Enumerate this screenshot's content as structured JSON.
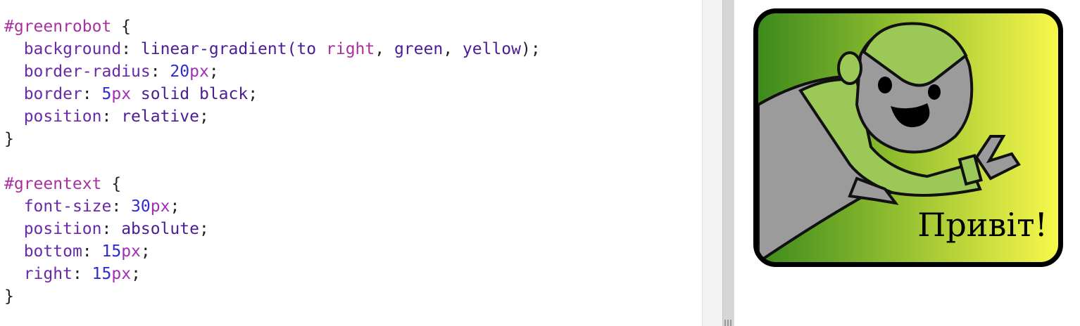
{
  "editor": {
    "lines": [
      {
        "selector": "#greenrobot",
        "open": " {"
      },
      {
        "property": "background",
        "tokens": [
          {
            "t": "linear-gradient(to ",
            "c": "val"
          },
          {
            "t": "right",
            "c": "sel"
          },
          {
            "t": ", ",
            "c": "punc"
          },
          {
            "t": "green",
            "c": "val"
          },
          {
            "t": ", ",
            "c": "punc"
          },
          {
            "t": "yellow",
            "c": "val"
          },
          {
            "t": ");",
            "c": "punc"
          }
        ]
      },
      {
        "property": "border-radius",
        "tokens": [
          {
            "t": "20",
            "c": "num"
          },
          {
            "t": "px",
            "c": "unit"
          },
          {
            "t": ";",
            "c": "punc"
          }
        ]
      },
      {
        "property": "border",
        "tokens": [
          {
            "t": "5",
            "c": "num"
          },
          {
            "t": "px",
            "c": "unit"
          },
          {
            "t": " solid black",
            "c": "val"
          },
          {
            "t": ";",
            "c": "punc"
          }
        ]
      },
      {
        "property": "position",
        "tokens": [
          {
            "t": "relative",
            "c": "val"
          },
          {
            "t": ";",
            "c": "punc"
          }
        ]
      },
      {
        "close": "}"
      },
      {
        "blank": true
      },
      {
        "selector": "#greentext",
        "open": " {"
      },
      {
        "property": "font-size",
        "tokens": [
          {
            "t": "30",
            "c": "num"
          },
          {
            "t": "px",
            "c": "unit"
          },
          {
            "t": ";",
            "c": "punc"
          }
        ]
      },
      {
        "property": "position",
        "tokens": [
          {
            "t": "absolute",
            "c": "val"
          },
          {
            "t": ";",
            "c": "punc"
          }
        ]
      },
      {
        "property": "bottom",
        "tokens": [
          {
            "t": "15",
            "c": "num"
          },
          {
            "t": "px",
            "c": "unit"
          },
          {
            "t": ";",
            "c": "punc"
          }
        ]
      },
      {
        "property": "right",
        "tokens": [
          {
            "t": "15",
            "c": "num"
          },
          {
            "t": "px",
            "c": "unit"
          },
          {
            "t": ";",
            "c": "punc"
          }
        ]
      },
      {
        "close": "}"
      }
    ]
  },
  "preview": {
    "greeting": "Привіт!",
    "card_colors": {
      "border": "#000000",
      "gradient_start": "#3d8a1c",
      "gradient_end": "#f8f84b"
    },
    "image_icon": "green-robot-illustration"
  }
}
